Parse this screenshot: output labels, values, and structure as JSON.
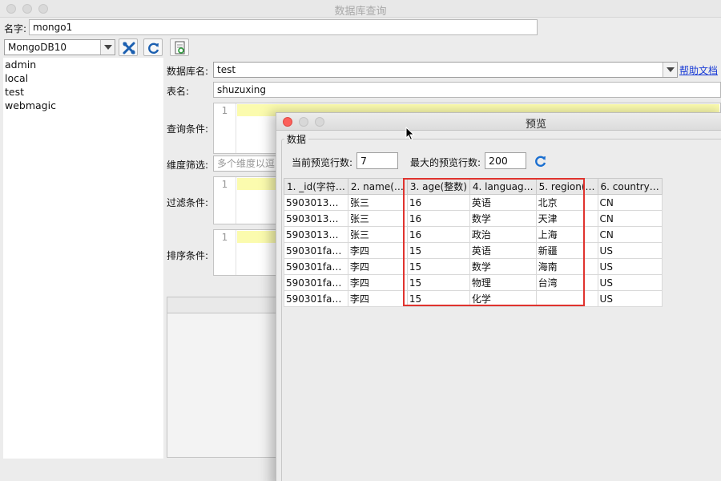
{
  "window": {
    "title": "数据库查询"
  },
  "form": {
    "name_label": "名字:",
    "name_value": "mongo1",
    "connection_value": "MongoDB10",
    "db_label": "数据库名:",
    "db_value": "test",
    "help_link": "帮助文档",
    "table_label": "表名:",
    "table_value": "shuzuxing",
    "query_label": "查询条件:",
    "dimension_label": "维度筛选:",
    "dimension_placeholder": "多个维度以逗",
    "filter_label": "过滤条件:",
    "sort_label": "排序条件:",
    "line_number": "1"
  },
  "databases": [
    "admin",
    "local",
    "test",
    "webmagic"
  ],
  "preview": {
    "title": "预览",
    "group_label": "数据",
    "current_rows_label": "当前预览行数:",
    "current_rows_value": "7",
    "max_rows_label": "最大的预览行数:",
    "max_rows_value": "200",
    "columns": [
      "1. _id(字符…",
      "2. name(…",
      "3. age(整数)",
      "4. languag…",
      "5. region(…",
      "6. country…"
    ],
    "rows": [
      [
        "5903013…",
        "张三",
        "16",
        "英语",
        "北京",
        "CN"
      ],
      [
        "5903013…",
        "张三",
        "16",
        "数学",
        "天津",
        "CN"
      ],
      [
        "5903013…",
        "张三",
        "16",
        "政治",
        "上海",
        "CN"
      ],
      [
        "590301fa…",
        "李四",
        "15",
        "英语",
        "新疆",
        "US"
      ],
      [
        "590301fa…",
        "李四",
        "15",
        "数学",
        "海南",
        "US"
      ],
      [
        "590301fa…",
        "李四",
        "15",
        "物理",
        "台湾",
        "US"
      ],
      [
        "590301fa…",
        "李四",
        "15",
        "化学",
        "",
        "US"
      ]
    ]
  },
  "colors": {
    "highlight_box": "#e0332e",
    "link": "#1a3cd6",
    "editor_highlight": "#fbfbae"
  }
}
